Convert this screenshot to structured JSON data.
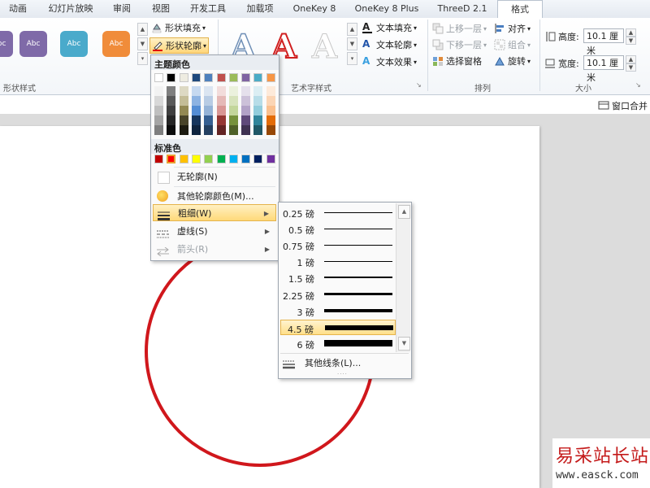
{
  "tabs": [
    "动画",
    "幻灯片放映",
    "审阅",
    "视图",
    "开发工具",
    "加载项",
    "OneKey 8",
    "OneKey 8 Plus",
    "ThreeD 2.1",
    "格式"
  ],
  "shape_styles": {
    "group_label": "形状样式",
    "sample_text": "Abc",
    "colors": [
      "#7f6aa8",
      "#7f6aa8",
      "#4aaacb",
      "#f08c3a"
    ],
    "fill_label": "形状填充",
    "outline_label": "形状轮廓"
  },
  "wordart": {
    "group_label": "艺术字样式",
    "sample_letter": "A",
    "text_fill": "文本填充",
    "text_outline": "文本轮廓",
    "text_effect": "文本效果"
  },
  "arrange": {
    "group_label": "排列",
    "bring_forward": "上移一层",
    "send_backward": "下移一层",
    "selection_pane": "选择窗格",
    "align": "对齐",
    "group": "组合",
    "rotate": "旋转"
  },
  "size": {
    "group_label": "大小",
    "height_label": "高度:",
    "height_value": "10.1 厘米",
    "width_label": "宽度:",
    "width_value": "10.1 厘米"
  },
  "infobar": {
    "window_merge": "窗口合并"
  },
  "outline_menu": {
    "theme_heading": "主题颜色",
    "standard_heading": "标准色",
    "theme_top_row": [
      "#ffffff",
      "#000000",
      "#eeece1",
      "#1f497d",
      "#4f81bd",
      "#c0504d",
      "#9bbb59",
      "#8064a2",
      "#4bacc6",
      "#f79646"
    ],
    "theme_columns": [
      [
        "#f2f2f2",
        "#d8d8d8",
        "#bfbfbf",
        "#a5a5a5",
        "#7f7f7f"
      ],
      [
        "#7f7f7f",
        "#595959",
        "#3f3f3f",
        "#262626",
        "#0c0c0c"
      ],
      [
        "#ddd9c3",
        "#c4bd97",
        "#938953",
        "#494429",
        "#1d1b10"
      ],
      [
        "#c6d9f0",
        "#8db3e2",
        "#548dd4",
        "#17365d",
        "#0f243e"
      ],
      [
        "#dbe5f1",
        "#b8cce4",
        "#95b3d7",
        "#366092",
        "#244061"
      ],
      [
        "#f2dcdb",
        "#e5b9b7",
        "#d99694",
        "#953734",
        "#632423"
      ],
      [
        "#ebf1dd",
        "#d7e3bc",
        "#c3d69b",
        "#76923c",
        "#4f6128"
      ],
      [
        "#e5e0ec",
        "#ccc1d9",
        "#b2a2c7",
        "#5f497a",
        "#3f3151"
      ],
      [
        "#dbeef3",
        "#b7dde8",
        "#92cddc",
        "#31859b",
        "#205867"
      ],
      [
        "#fdeada",
        "#fbd5b5",
        "#fac08f",
        "#e36c09",
        "#974806"
      ]
    ],
    "standard_colors": [
      "#c00000",
      "#ff0000",
      "#ffc000",
      "#ffff00",
      "#92d050",
      "#00b050",
      "#00b0f0",
      "#0070c0",
      "#002060",
      "#7030a0"
    ],
    "no_outline": "无轮廓(N)",
    "more_colors": "其他轮廓颜色(M)...",
    "weight": "粗细(W)",
    "dashes": "虚线(S)",
    "arrows": "箭头(R)"
  },
  "weight_menu": {
    "items": [
      {
        "label": "0.25 磅",
        "pt": 0.25
      },
      {
        "label": "0.5 磅",
        "pt": 0.5
      },
      {
        "label": "0.75 磅",
        "pt": 0.75
      },
      {
        "label": "1 磅",
        "pt": 1
      },
      {
        "label": "1.5 磅",
        "pt": 1.5
      },
      {
        "label": "2.25 磅",
        "pt": 2.25
      },
      {
        "label": "3 磅",
        "pt": 3
      },
      {
        "label": "4.5 磅",
        "pt": 4.5
      },
      {
        "label": "6 磅",
        "pt": 6
      }
    ],
    "selected_index": 7,
    "more_lines": "其他线条(L)..."
  },
  "shape": {
    "outline_color": "#d0171c"
  },
  "watermark": {
    "title": "易采站长站",
    "url": "www.easck.com"
  }
}
